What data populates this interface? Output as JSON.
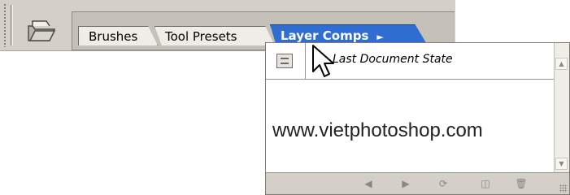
{
  "toolbar": {
    "file_browser_icon": "folder-open-icon"
  },
  "palette_well": {
    "tabs": [
      {
        "label": "Brushes",
        "active": false
      },
      {
        "label": "Tool Presets",
        "active": false
      },
      {
        "label": "Layer Comps",
        "active": true,
        "arrow": "►"
      }
    ],
    "active_color": "#2f6ed0"
  },
  "layer_comps_panel": {
    "rows": [
      {
        "icon": "document-state-icon",
        "label": "Last Document State"
      }
    ],
    "watermark": "www.vietphotoshop.com",
    "footer_buttons": [
      {
        "name": "previous-icon",
        "glyph": "◀"
      },
      {
        "name": "next-icon",
        "glyph": "▶"
      },
      {
        "name": "refresh-icon",
        "glyph": "⟳"
      },
      {
        "name": "new-comp-icon",
        "glyph": "◫"
      },
      {
        "name": "trash-icon",
        "glyph": "🗑"
      }
    ]
  }
}
